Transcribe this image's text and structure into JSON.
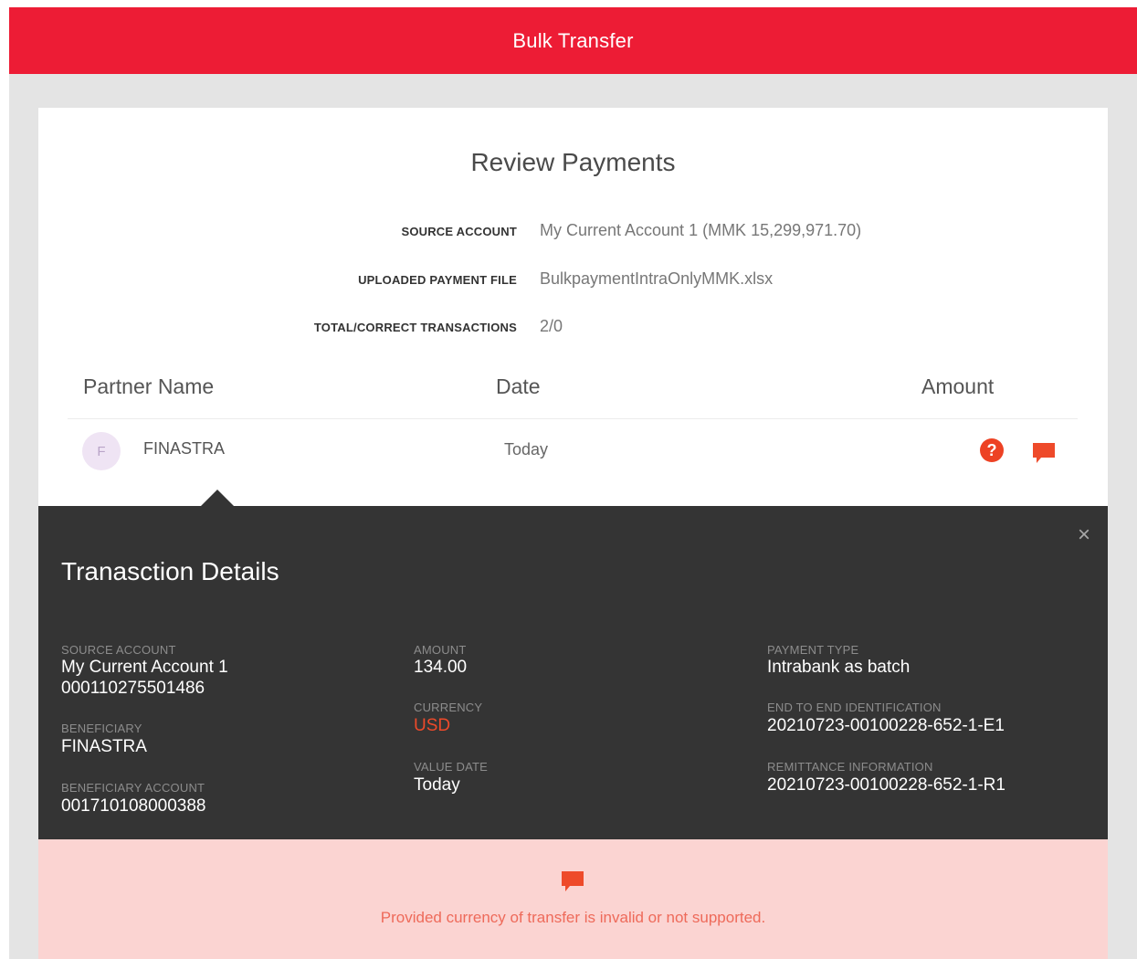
{
  "header": {
    "title": "Bulk Transfer"
  },
  "review": {
    "title": "Review Payments",
    "info": [
      {
        "label": "SOURCE ACCOUNT",
        "value": "My Current Account 1 (MMK 15,299,971.70)"
      },
      {
        "label": "UPLOADED PAYMENT FILE",
        "value": "BulkpaymentIntraOnlyMMK.xlsx"
      },
      {
        "label": "TOTAL/CORRECT TRANSACTIONS",
        "value": "2/0"
      }
    ],
    "columns": {
      "partner": "Partner Name",
      "date": "Date",
      "amount": "Amount"
    },
    "row": {
      "avatar_letter": "F",
      "partner": "FINASTRA",
      "date": "Today",
      "help_icon": "question-circle-icon",
      "comment_icon": "chat-bubble-icon"
    }
  },
  "details": {
    "title": "Tranasction Details",
    "close_icon": "close-icon",
    "source_account_label": "SOURCE ACCOUNT",
    "source_account_name": "My Current Account 1",
    "source_account_number": "000110275501486",
    "beneficiary_label": "BENEFICIARY",
    "beneficiary": "FINASTRA",
    "beneficiary_account_label": "BENEFICIARY ACCOUNT",
    "beneficiary_account": "001710108000388",
    "amount_label": "AMOUNT",
    "amount": "134.00",
    "currency_label": "CURRENCY",
    "currency": "USD",
    "value_date_label": "VALUE DATE",
    "value_date": "Today",
    "payment_type_label": "PAYMENT TYPE",
    "payment_type": "Intrabank as batch",
    "e2e_label": "END TO END IDENTIFICATION",
    "e2e": "20210723-00100228-652-1-E1",
    "remittance_label": "REMITTANCE INFORMATION",
    "remittance": "20210723-00100228-652-1-R1"
  },
  "error": {
    "icon": "chat-bubble-icon",
    "message": "Provided currency of transfer is invalid or not supported."
  },
  "colors": {
    "brand_red": "#ed1c35",
    "panel_dark": "#343434",
    "error_bg": "#fbd4d2",
    "accent_orange": "#ed4224"
  }
}
